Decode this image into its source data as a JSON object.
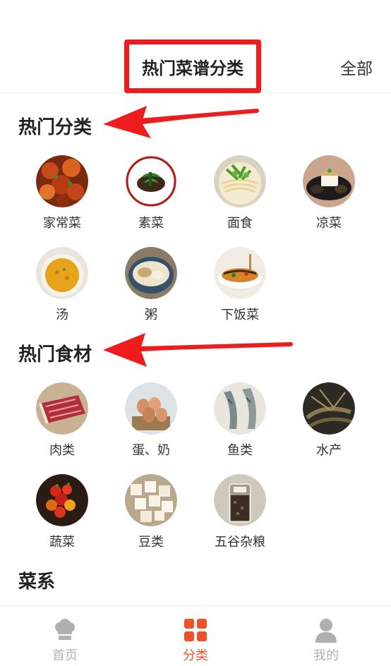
{
  "header": {
    "title": "热门菜谱分类",
    "all_label": "全部"
  },
  "sections": {
    "hot_categories": {
      "title": "热门分类",
      "items": [
        {
          "label": "家常菜",
          "icon": "home-dish-photo"
        },
        {
          "label": "素菜",
          "icon": "vegetarian-dish-photo"
        },
        {
          "label": "面食",
          "icon": "noodles-photo"
        },
        {
          "label": "凉菜",
          "icon": "cold-dish-photo"
        },
        {
          "label": "汤",
          "icon": "soup-photo"
        },
        {
          "label": "粥",
          "icon": "porridge-photo"
        },
        {
          "label": "下饭菜",
          "icon": "rice-dish-photo"
        }
      ]
    },
    "hot_ingredients": {
      "title": "热门食材",
      "items": [
        {
          "label": "肉类",
          "icon": "meat-photo"
        },
        {
          "label": "蛋、奶",
          "icon": "eggs-photo"
        },
        {
          "label": "鱼类",
          "icon": "fish-photo"
        },
        {
          "label": "水产",
          "icon": "seafood-photo"
        },
        {
          "label": "蔬菜",
          "icon": "vegetables-photo"
        },
        {
          "label": "豆类",
          "icon": "tofu-photo"
        },
        {
          "label": "五谷杂粮",
          "icon": "grains-photo"
        }
      ]
    },
    "cuisines": {
      "title": "菜系"
    }
  },
  "tabbar": {
    "items": [
      {
        "label": "首页",
        "icon": "chef-hat-icon",
        "active": false
      },
      {
        "label": "分类",
        "icon": "grid-icon",
        "active": true
      },
      {
        "label": "我的",
        "icon": "user-icon",
        "active": false
      }
    ]
  },
  "colors": {
    "accent": "#f0512a",
    "annotation_red": "#ee1c1c",
    "inactive": "#b0b0b0",
    "text": "#333333"
  }
}
